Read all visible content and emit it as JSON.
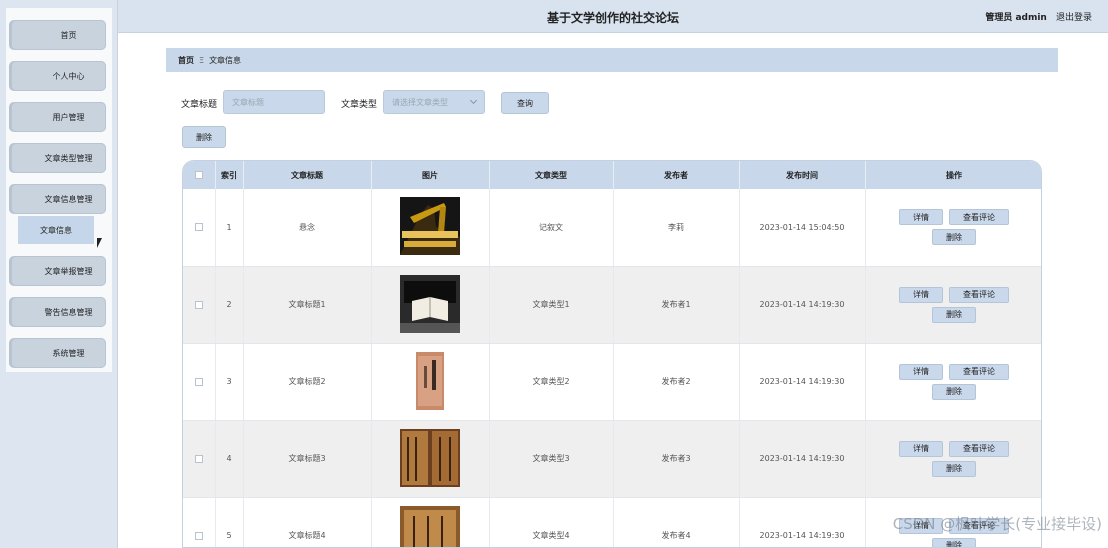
{
  "header": {
    "title": "基于文学创作的社交论坛",
    "user": "管理员 admin",
    "logout": "退出登录"
  },
  "sidebar": {
    "items": [
      {
        "label": "首页"
      },
      {
        "label": "个人中心"
      },
      {
        "label": "用户管理"
      },
      {
        "label": "文章类型管理"
      },
      {
        "label": "文章信息管理"
      },
      {
        "label": "文章举报管理"
      },
      {
        "label": "警告信息管理"
      },
      {
        "label": "系统管理"
      }
    ],
    "active_sub": "文章信息"
  },
  "breadcrumb": {
    "home": "首页",
    "current": "文章信息"
  },
  "search": {
    "title_label": "文章标题",
    "title_placeholder": "文章标题",
    "type_label": "文章类型",
    "type_placeholder": "请选择文章类型",
    "query_button": "查询",
    "delete_button": "删除"
  },
  "table": {
    "headers": [
      "索引",
      "文章标题",
      "图片",
      "文章类型",
      "发布者",
      "发布时间",
      "操作"
    ],
    "rows": [
      {
        "index": "1",
        "title": "悬念",
        "type": "记叙文",
        "publisher": "李莉",
        "time": "2023-01-14 15:04:50"
      },
      {
        "index": "2",
        "title": "文章标题1",
        "type": "文章类型1",
        "publisher": "发布者1",
        "time": "2023-01-14 14:19:30"
      },
      {
        "index": "3",
        "title": "文章标题2",
        "type": "文章类型2",
        "publisher": "发布者2",
        "time": "2023-01-14 14:19:30"
      },
      {
        "index": "4",
        "title": "文章标题3",
        "type": "文章类型3",
        "publisher": "发布者3",
        "time": "2023-01-14 14:19:30"
      },
      {
        "index": "5",
        "title": "文章标题4",
        "type": "文章类型4",
        "publisher": "发布者4",
        "time": "2023-01-14 14:19:30"
      }
    ],
    "ops": {
      "detail": "详情",
      "comments": "查看评论",
      "delete": "删除"
    }
  },
  "watermark": "CSDN @枫叶学长(专业接毕设)"
}
